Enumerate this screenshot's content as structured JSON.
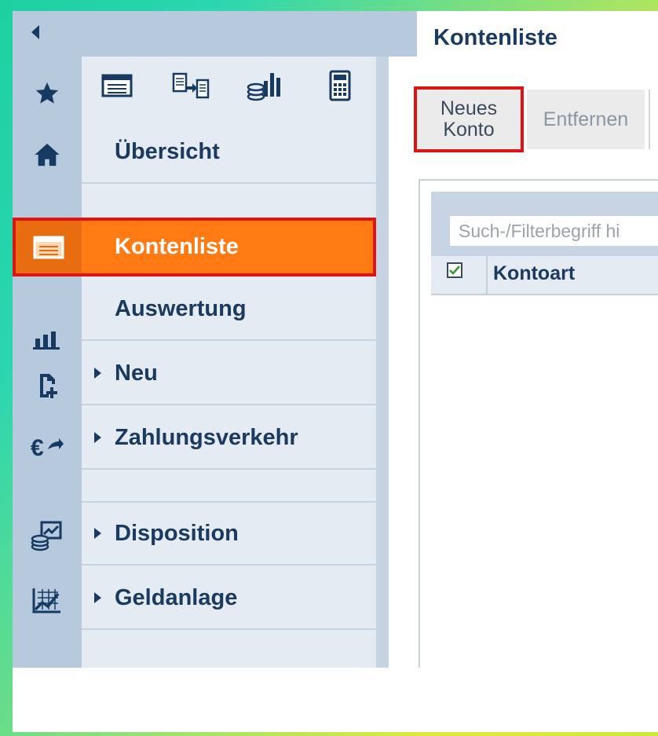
{
  "sidebar": {
    "rail_icons": [
      "collapse-arrow-icon",
      "star-icon",
      "home-icon",
      "account-list-icon",
      "bar-chart-icon",
      "new-document-icon",
      "euro-transfer-icon",
      "coins-chart-icon",
      "investment-chart-icon"
    ],
    "quick_tools": [
      "account-list-icon",
      "transfer-list-icon",
      "coins-bar-icon",
      "calculator-icon"
    ],
    "items": [
      {
        "label": "Übersicht",
        "expandable": false
      },
      {
        "label": "Kontenliste",
        "expandable": false,
        "active": true
      },
      {
        "label": "Auswertung",
        "expandable": false
      },
      {
        "label": "Neu",
        "expandable": true
      },
      {
        "label": "Zahlungsverkehr",
        "expandable": true
      },
      {
        "label": "Disposition",
        "expandable": true
      },
      {
        "label": "Geldanlage",
        "expandable": true
      }
    ]
  },
  "main": {
    "title": "Kontenliste",
    "toolbar": {
      "new_account_line1": "Neues",
      "new_account_line2": "Konto",
      "remove_label": "Entfernen"
    },
    "search": {
      "placeholder": "Such-/Filterbegriff hi"
    },
    "table": {
      "columns": [
        "Kontoart"
      ],
      "select_all_checked": true
    }
  },
  "colors": {
    "accent_orange": "#ff7a12",
    "highlight_red": "#e11212",
    "navy": "#1b3a60",
    "rail_blue": "#b7c9dd"
  }
}
